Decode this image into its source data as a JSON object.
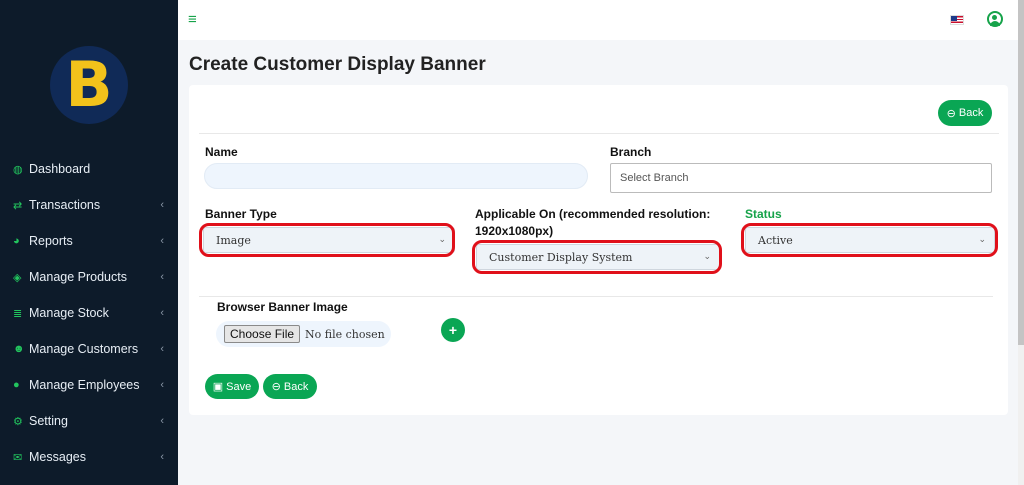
{
  "logo": {
    "letter": "B"
  },
  "sidebar": {
    "items": [
      {
        "label": "Dashboard",
        "icon": "tachometer-icon",
        "has_chevron": false
      },
      {
        "label": "Transactions",
        "icon": "exchange-icon",
        "has_chevron": true
      },
      {
        "label": "Reports",
        "icon": "pie-chart-icon",
        "has_chevron": true
      },
      {
        "label": "Manage Products",
        "icon": "cube-icon",
        "has_chevron": true
      },
      {
        "label": "Manage Stock",
        "icon": "database-icon",
        "has_chevron": true
      },
      {
        "label": "Manage Customers",
        "icon": "users-icon",
        "has_chevron": true
      },
      {
        "label": "Manage Employees",
        "icon": "user-icon",
        "has_chevron": true
      },
      {
        "label": "Setting",
        "icon": "cogs-icon",
        "has_chevron": true
      },
      {
        "label": "Messages",
        "icon": "envelope-icon",
        "has_chevron": true
      }
    ]
  },
  "page": {
    "title": "Create Customer Display Banner"
  },
  "form": {
    "back_top_label": "Back",
    "name_label": "Name",
    "name_value": "",
    "branch_label": "Branch",
    "branch_placeholder": "Select Branch",
    "banner_type_label": "Banner Type",
    "banner_type_value": "Image",
    "applicable_label_line1": "Applicable On (recommended resolution:",
    "applicable_label_line2": "1920x1080px)",
    "applicable_value": "Customer Display System",
    "status_label": "Status",
    "status_value": "Active",
    "image_label": "Browser Banner Image",
    "file_button": "Choose File",
    "file_status": "No file chosen",
    "save_label": "Save",
    "back_bottom_label": "Back"
  },
  "colors": {
    "accent": "#0aa654",
    "sidebar_bg": "#0d1b2a",
    "highlight": "#e0101a",
    "status_label": "#16a34a"
  }
}
